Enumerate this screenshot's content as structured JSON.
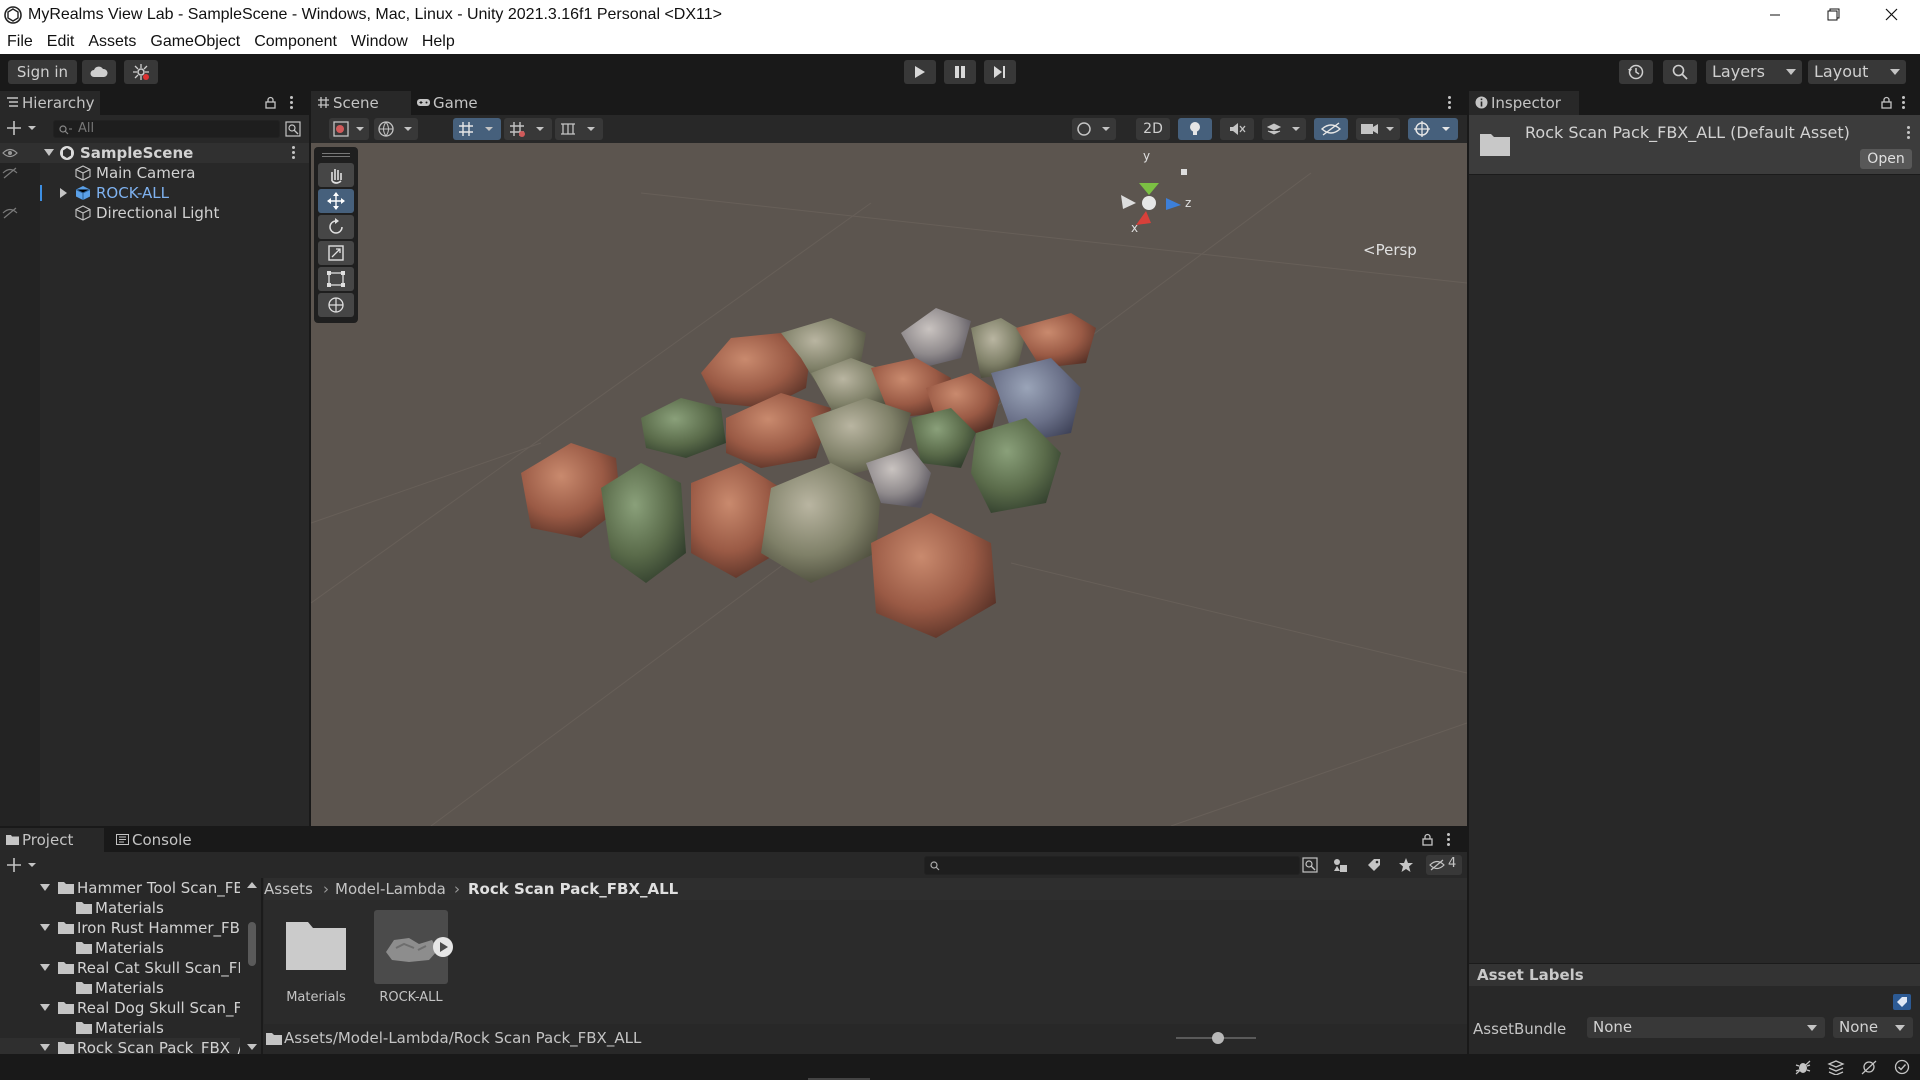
{
  "window": {
    "title": "MyRealms View Lab - SampleScene - Windows, Mac, Linux - Unity 2021.3.16f1 Personal <DX11>"
  },
  "menu": [
    "File",
    "Edit",
    "Assets",
    "GameObject",
    "Component",
    "Window",
    "Help"
  ],
  "toolbar": {
    "sign_in": "Sign in",
    "layers": "Layers",
    "layout": "Layout"
  },
  "hierarchy": {
    "tab": "Hierarchy",
    "search_placeholder": "All",
    "scene": "SampleScene",
    "items": [
      "Main Camera",
      "ROCK-ALL",
      "Directional Light"
    ]
  },
  "scene_view": {
    "tabs": [
      "Scene",
      "Game"
    ],
    "toggle_2d": "2D",
    "projection": "Persp",
    "gizmo_axes": {
      "y": "y",
      "z": "z",
      "x": "x"
    }
  },
  "inspector": {
    "tab": "Inspector",
    "asset_name": "Rock Scan Pack_FBX_ALL (Default Asset)",
    "open_button": "Open",
    "asset_labels": "Asset Labels",
    "assetbundle_label": "AssetBundle",
    "assetbundle_value": "None",
    "variant_value": "None"
  },
  "project": {
    "tabs": [
      "Project",
      "Console"
    ],
    "hidden_count": "4",
    "tree": [
      {
        "label": "Hammer Tool Scan_FB",
        "indent": 0
      },
      {
        "label": "Materials",
        "indent": 1
      },
      {
        "label": "Iron Rust Hammer_FBX",
        "indent": 0
      },
      {
        "label": "Materials",
        "indent": 1
      },
      {
        "label": "Real Cat Skull Scan_FE",
        "indent": 0
      },
      {
        "label": "Materials",
        "indent": 1
      },
      {
        "label": "Real Dog Skull Scan_Fl",
        "indent": 0
      },
      {
        "label": "Materials",
        "indent": 1
      },
      {
        "label": "Rock Scan Pack_FBX_/",
        "indent": 0
      }
    ],
    "breadcrumb": [
      "Assets",
      "Model-Lambda",
      "Rock Scan Pack_FBX_ALL"
    ],
    "assets": [
      "Materials",
      "ROCK-ALL"
    ],
    "path": "Assets/Model-Lambda/Rock Scan Pack_FBX_ALL"
  },
  "colors": {
    "accent_selected": "#46607c",
    "link_blue": "#7fb2f0",
    "viewport_bg": "#5c554f"
  }
}
